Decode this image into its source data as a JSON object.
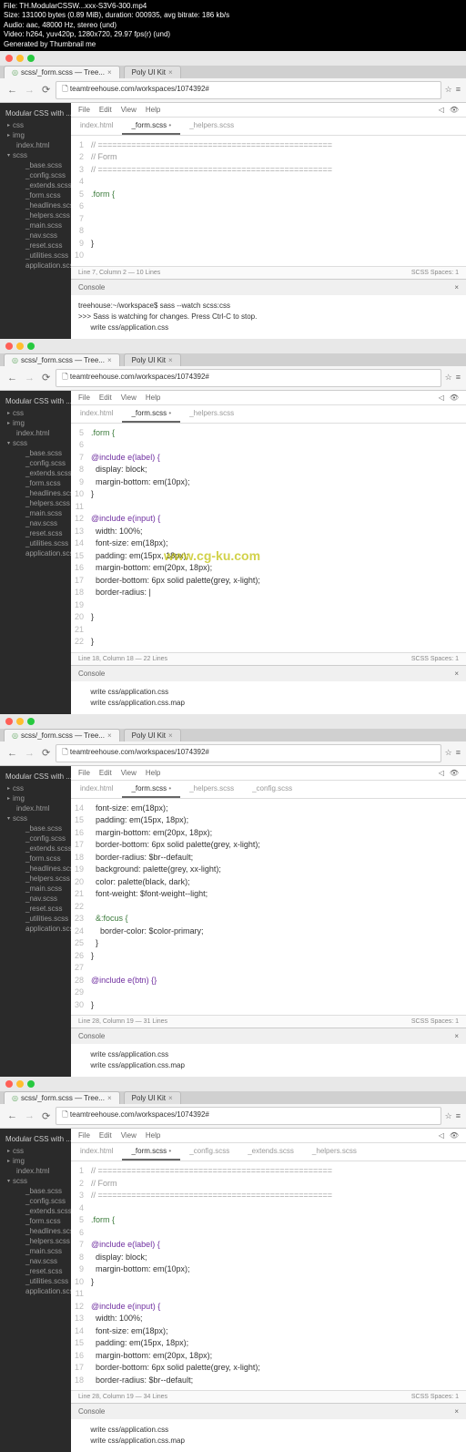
{
  "metadata": {
    "line1": "File: TH.ModularCSSW...xxx-S3V6-300.mp4",
    "line2": "Size: 131000 bytes (0.89 MiB), duration: 000935, avg bitrate: 186 kb/s",
    "line3": "Audio: aac, 48000 Hz, stereo (und)",
    "line4": "Video: h264, yuv420p, 1280x720, 29.97 fps(r) (und)",
    "line5": "Generated by Thumbnail me"
  },
  "browser": {
    "tab1": "scss/_form.scss — Tree...",
    "tab2": "Poly UI Kit",
    "url": "teamtreehouse.com/workspaces/1074392#"
  },
  "sidebar": {
    "header": "Modular CSS with ...",
    "folders": {
      "css": "css",
      "img": "img",
      "scss": "scss"
    },
    "items": {
      "index": "index.html",
      "base": "_base.scss",
      "config": "_config.scss",
      "extends": "_extends.scss",
      "form": "_form.scss",
      "headlines": "_headlines.scss",
      "helpers": "_helpers.scss",
      "main": "_main.scss",
      "nav": "_nav.scss",
      "reset": "_reset.scss",
      "utilities": "_utilities.scss",
      "application": "application.scss"
    }
  },
  "menu": {
    "file": "File",
    "edit": "Edit",
    "view": "View",
    "help": "Help"
  },
  "filetabs": {
    "index": "index.html",
    "form": "_form.scss",
    "helpers": "_helpers.scss",
    "config": "_config.scss",
    "extends": "_extends.scss"
  },
  "code1": {
    "l1": "// =================================================",
    "l2": "// Form",
    "l3": "// =================================================",
    "l5": ".form {",
    "l9": "}"
  },
  "status1": {
    "left": "Line 7, Column 2 — 10 Lines",
    "right": "SCSS    Spaces: 1"
  },
  "console": {
    "header": "Console",
    "c1_l1": "treehouse:~/workspace$ sass --watch scss:css",
    "c1_l2": ">>> Sass is watching for changes. Press Ctrl-C to stop.",
    "c1_l3": "      write css/application.css",
    "c2_l1": "      write css/application.css",
    "c2_l2": "      write css/application.css.map",
    "c3_l1": "      write css/application.css",
    "c3_l2": "      write css/application.css.map",
    "c4_l1": "      write css/application.css",
    "c4_l2": "      write css/application.css.map"
  },
  "code2": {
    "l5": ".form {",
    "l7": "@include e(label) {",
    "l8": "  display: block;",
    "l9": "  margin-bottom: em(10px);",
    "l10": "}",
    "l12": "@include e(input) {",
    "l13": "  width: 100%;",
    "l14": "  font-size: em(18px);",
    "l15": "  padding: em(15px, 18px);",
    "l16": "  margin-bottom: em(20px, 18px);",
    "l17": "  border-bottom: 6px solid palette(grey, x-light);",
    "l18": "  border-radius: |",
    "l20": "}",
    "l22": "}"
  },
  "status2": {
    "left": "Line 18, Column 18 — 22 Lines",
    "right": "SCSS    Spaces: 1"
  },
  "watermark": "www.cg-ku.com",
  "code3": {
    "l14": "  font-size: em(18px);",
    "l15": "  padding: em(15px, 18px);",
    "l16": "  margin-bottom: em(20px, 18px);",
    "l17": "  border-bottom: 6px solid palette(grey, x-light);",
    "l18": "  border-radius: $br--default;",
    "l19": "  background: palette(grey, xx-light);",
    "l20": "  color: palette(black, dark);",
    "l21": "  font-weight: $font-weight--light;",
    "l23": "  &:focus {",
    "l24": "    border-color: $color-primary;",
    "l25": "  }",
    "l26": "}",
    "l28": "@include e(btn) {}",
    "l30": "}"
  },
  "status3": {
    "left": "Line 28, Column 19 — 31 Lines",
    "right": "SCSS    Spaces: 1"
  },
  "code4": {
    "l1": "// =================================================",
    "l2": "// Form",
    "l3": "// =================================================",
    "l5": ".form {",
    "l7": "@include e(label) {",
    "l8": "  display: block;",
    "l9": "  margin-bottom: em(10px);",
    "l10": "}",
    "l12": "@include e(input) {",
    "l13": "  width: 100%;",
    "l14": "  font-size: em(18px);",
    "l15": "  padding: em(15px, 18px);",
    "l16": "  margin-bottom: em(20px, 18px);",
    "l17": "  border-bottom: 6px solid palette(grey, x-light);",
    "l18": "  border-radius: $br--default;"
  },
  "status4": {
    "left": "Line 28, Column 19 — 34 Lines",
    "right": "SCSS    Spaces: 1"
  }
}
